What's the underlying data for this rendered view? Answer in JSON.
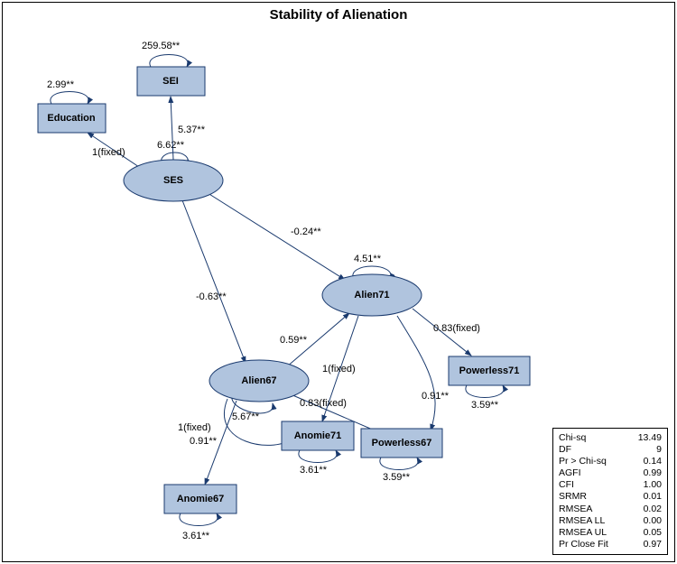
{
  "title": "Stability of Alienation",
  "nodes": {
    "education": "Education",
    "sei": "SEI",
    "ses": "SES",
    "alien67": "Alien67",
    "alien71": "Alien71",
    "anomie67": "Anomie67",
    "anomie71": "Anomie71",
    "powerless67": "Powerless67",
    "powerless71": "Powerless71"
  },
  "edges": {
    "edu_var": "2.99**",
    "sei_var": "259.58**",
    "ses_var": "6.62**",
    "alien67_var": "5.67**",
    "alien71_var": "4.51**",
    "anomie67_var": "3.61**",
    "anomie71_var": "3.61**",
    "powerless67_var": "3.59**",
    "powerless71_var": "3.59**",
    "ses_to_edu": "1(fixed)",
    "ses_to_sei": "5.37**",
    "ses_to_alien67": "-0.63**",
    "ses_to_alien71": "-0.24**",
    "alien67_to_alien71": "0.59**",
    "alien67_to_anomie67": "1(fixed)",
    "alien67_to_anomie71": "0.91**",
    "alien67_to_powerless67": "0.83(fixed)",
    "alien71_to_anomie71": "1(fixed)",
    "alien71_to_powerless67": "0.91**",
    "alien71_to_powerless71": "0.83(fixed)"
  },
  "fit": {
    "chisq_l": "Chi-sq",
    "chisq_v": "13.49",
    "df_l": "DF",
    "df_v": "9",
    "pchi_l": "Pr > Chi-sq",
    "pchi_v": "0.14",
    "agfi_l": "AGFI",
    "agfi_v": "0.99",
    "cfi_l": "CFI",
    "cfi_v": "1.00",
    "srmr_l": "SRMR",
    "srmr_v": "0.01",
    "rmsea_l": "RMSEA",
    "rmsea_v": "0.02",
    "rmseall_l": "RMSEA LL",
    "rmseall_v": "0.00",
    "rmseaul_l": "RMSEA UL",
    "rmseaul_v": "0.05",
    "pclose_l": "Pr Close Fit",
    "pclose_v": "0.97"
  }
}
